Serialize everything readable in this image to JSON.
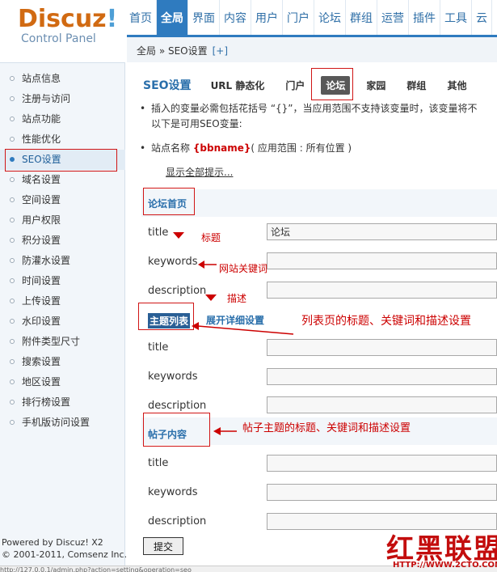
{
  "logo": {
    "brand": "Discuz",
    "excl": "!",
    "subtitle": "Control Panel"
  },
  "topnav": [
    "首页",
    "全局",
    "界面",
    "内容",
    "用户",
    "门户",
    "论坛",
    "群组",
    "运营",
    "插件",
    "工具",
    "云"
  ],
  "topnav_active": "全局",
  "breadcrumb": {
    "path": "全局 » SEO设置",
    "plus": "[+]"
  },
  "sidebar": {
    "items": [
      "站点信息",
      "注册与访问",
      "站点功能",
      "性能优化",
      "SEO设置",
      "域名设置",
      "空间设置",
      "用户权限",
      "积分设置",
      "防灌水设置",
      "时间设置",
      "上传设置",
      "水印设置",
      "附件类型尺寸",
      "搜索设置",
      "地区设置",
      "排行榜设置",
      "手机版访问设置"
    ],
    "active": "SEO设置"
  },
  "footer": {
    "powered": "Powered by",
    "product": "Discuz! X2",
    "copyright": "© 2001-2011, Comsenz Inc."
  },
  "page": {
    "title": "SEO设置",
    "tabs": [
      "URL 静态化",
      "门户",
      "论坛",
      "家园",
      "群组",
      "其他"
    ],
    "selected_tab": "论坛"
  },
  "tips": {
    "line1": "插入的变量必需包括花括号 “{}”，当应用范围不支持该变量时，该变量将不",
    "line2": "以下是可用SEO变量:",
    "var_label": "站点名称",
    "var_name": "{bbname}",
    "var_scope": "( 应用范围 : 所有位置 )",
    "show_all": "显示全部提示..."
  },
  "sections": {
    "index": {
      "title": "论坛首页"
    },
    "list": {
      "title": "主题列表",
      "expand": "展开详细设置"
    },
    "post": {
      "title": "帖子内容"
    }
  },
  "fields": {
    "title_label": "title",
    "keywords_label": "keywords",
    "description_label": "description",
    "index_title_value": "论坛"
  },
  "annotations": {
    "title": "标题",
    "keywords": "网站关键词",
    "description": "描述",
    "list": "列表页的标题、关键词和描述设置",
    "post": "帖子主题的标题、关键词和描述设置"
  },
  "submit_label": "提交",
  "watermark": {
    "main": "红黑联盟",
    "url": "HTTP://WWW.2CTO.COM"
  },
  "status_url": "http://127.0.0.1/admin.php?action=setting&operation=seo",
  "colors": {
    "accent": "#2f7bbf",
    "annotation": "#cc0000",
    "brand": "#d16a12"
  }
}
